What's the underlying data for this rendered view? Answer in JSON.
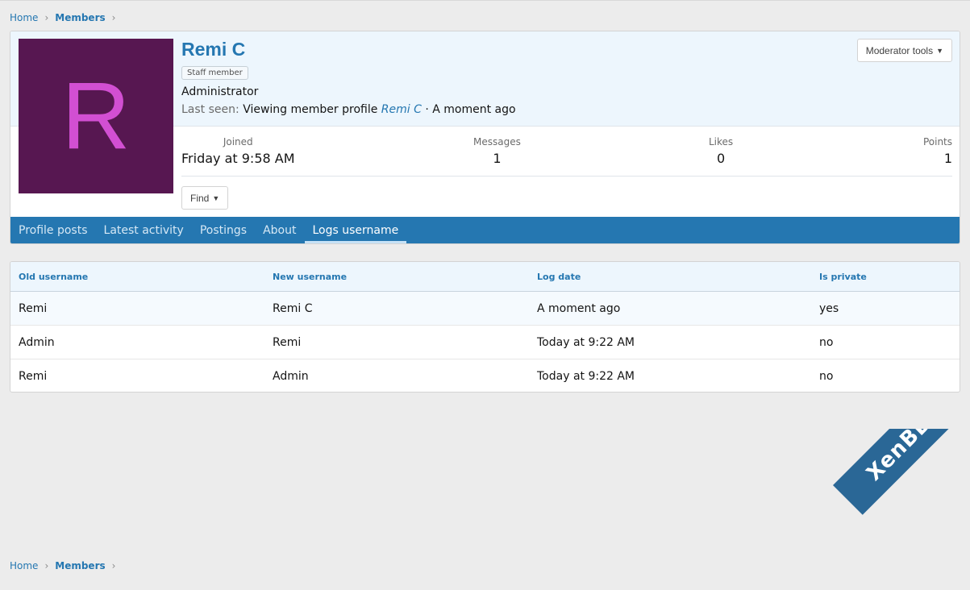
{
  "breadcrumb": {
    "home": "Home",
    "members": "Members",
    "sep": "›"
  },
  "profile": {
    "avatar_letter": "R",
    "username": "Remi C",
    "badge": "Staff member",
    "title": "Administrator",
    "last_seen_label": "Last seen:",
    "last_seen_activity": "Viewing member profile",
    "last_seen_user": "Remi C",
    "last_seen_time": "· A moment ago",
    "moderator_tools": "Moderator tools",
    "find": "Find",
    "stats": {
      "joined_label": "Joined",
      "joined_value": "Friday at 9:58 AM",
      "messages_label": "Messages",
      "messages_value": "1",
      "likes_label": "Likes",
      "likes_value": "0",
      "points_label": "Points",
      "points_value": "1"
    }
  },
  "tabs": [
    {
      "label": "Profile posts"
    },
    {
      "label": "Latest activity"
    },
    {
      "label": "Postings"
    },
    {
      "label": "About"
    },
    {
      "label": "Logs username",
      "active": true
    }
  ],
  "log_table": {
    "headers": [
      "Old username",
      "New username",
      "Log date",
      "Is private"
    ],
    "rows": [
      [
        "Remi",
        "Remi C",
        "A moment ago",
        "yes"
      ],
      [
        "Admin",
        "Remi",
        "Today at 9:22 AM",
        "no"
      ],
      [
        "Remi",
        "Admin",
        "Today at 9:22 AM",
        "no"
      ]
    ]
  },
  "watermark": "XenBD.Com",
  "colors": {
    "accent": "#2577b1",
    "avatar_bg": "#571751",
    "avatar_letter": "#d24fd2",
    "header_bg": "#edf6fd"
  }
}
